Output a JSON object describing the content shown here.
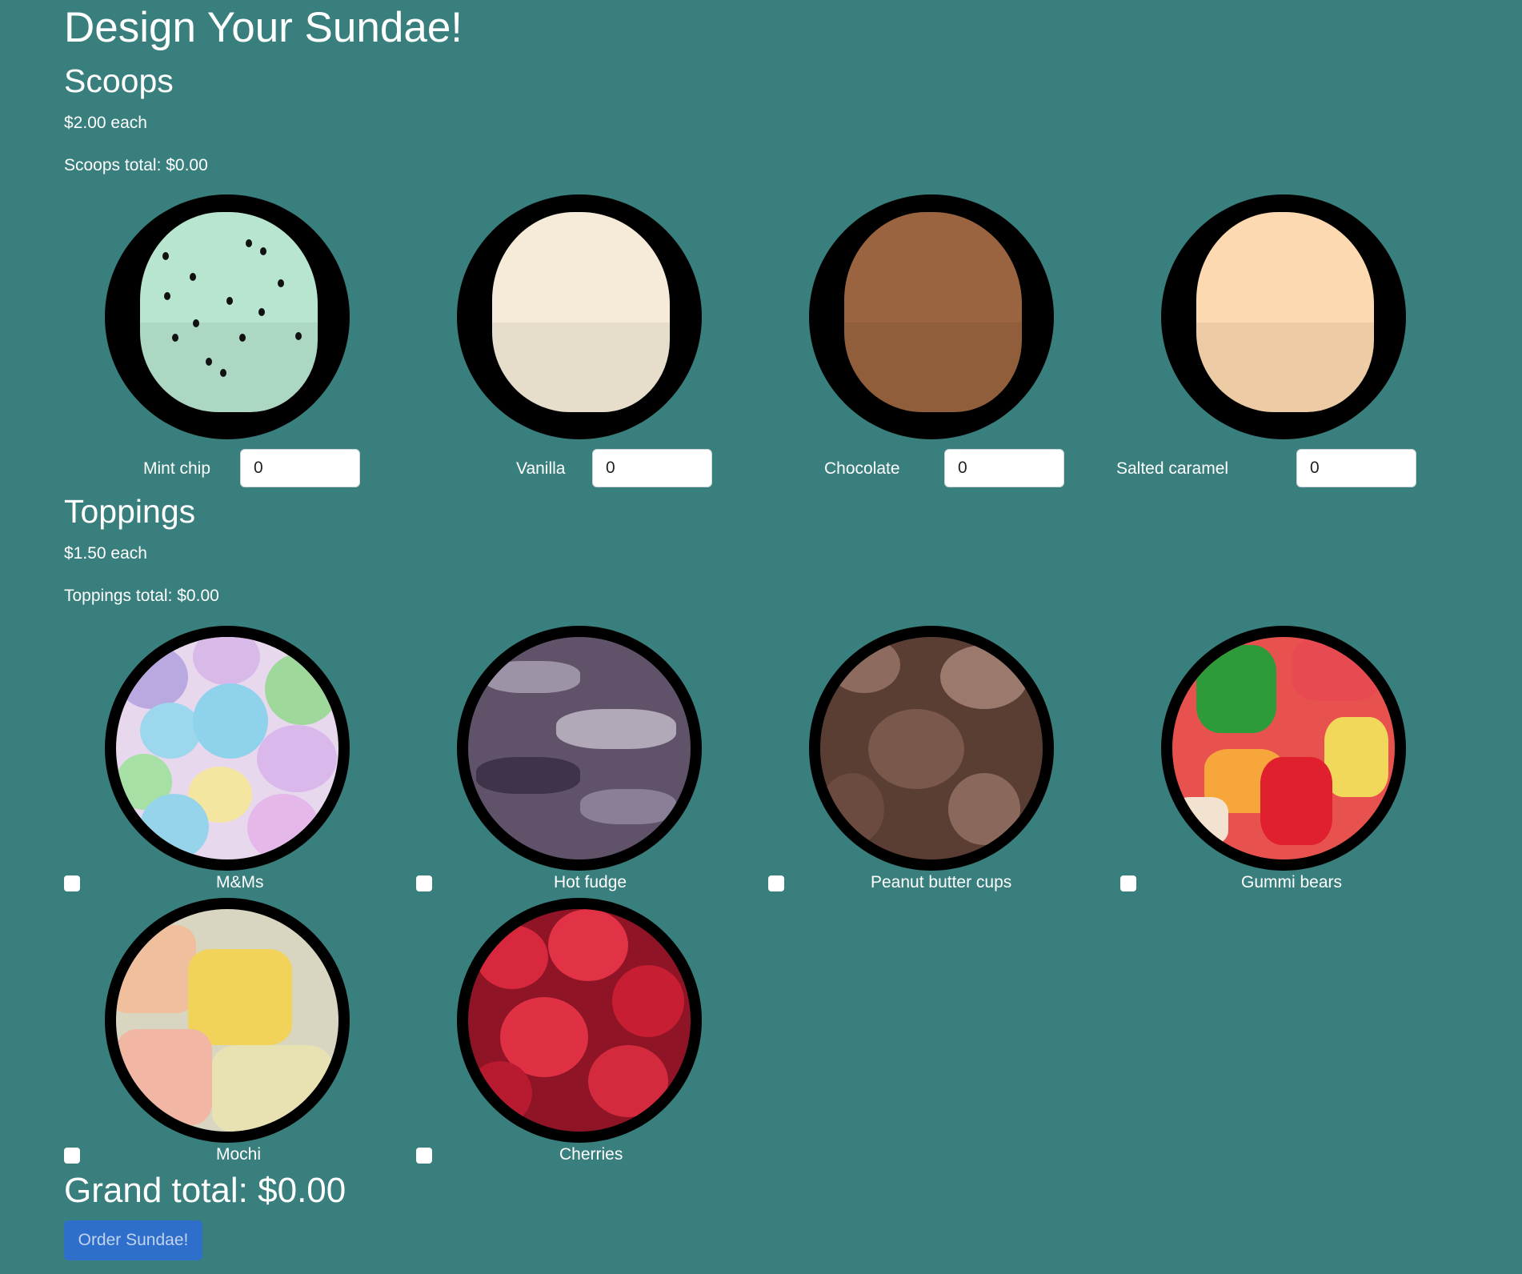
{
  "page": {
    "title": "Design Your Sundae!",
    "background": "#387F7D"
  },
  "scoops": {
    "heading": "Scoops",
    "price": "$2.00 each",
    "total": "Scoops total: $0.00",
    "items": [
      {
        "label": "Mint chip",
        "value": "0",
        "color": "#B7E5CF"
      },
      {
        "label": "Vanilla",
        "value": "0",
        "color": "#F6EBD8"
      },
      {
        "label": "Chocolate",
        "value": "0",
        "color": "#9B6440"
      },
      {
        "label": "Salted caramel",
        "value": "0",
        "color": "#FCD9B0"
      }
    ]
  },
  "toppings": {
    "heading": "Toppings",
    "price": "$1.50 each",
    "total": "Toppings total: $0.00",
    "items": [
      {
        "label": "M&Ms",
        "checked": false
      },
      {
        "label": "Hot fudge",
        "checked": false
      },
      {
        "label": "Peanut butter cups",
        "checked": false
      },
      {
        "label": "Gummi bears",
        "checked": false
      },
      {
        "label": "Mochi",
        "checked": false
      },
      {
        "label": "Cherries",
        "checked": false
      }
    ]
  },
  "summary": {
    "grand_total": "Grand total: $0.00",
    "order_button": "Order Sundae!",
    "button_color": "#2F6FD1"
  }
}
